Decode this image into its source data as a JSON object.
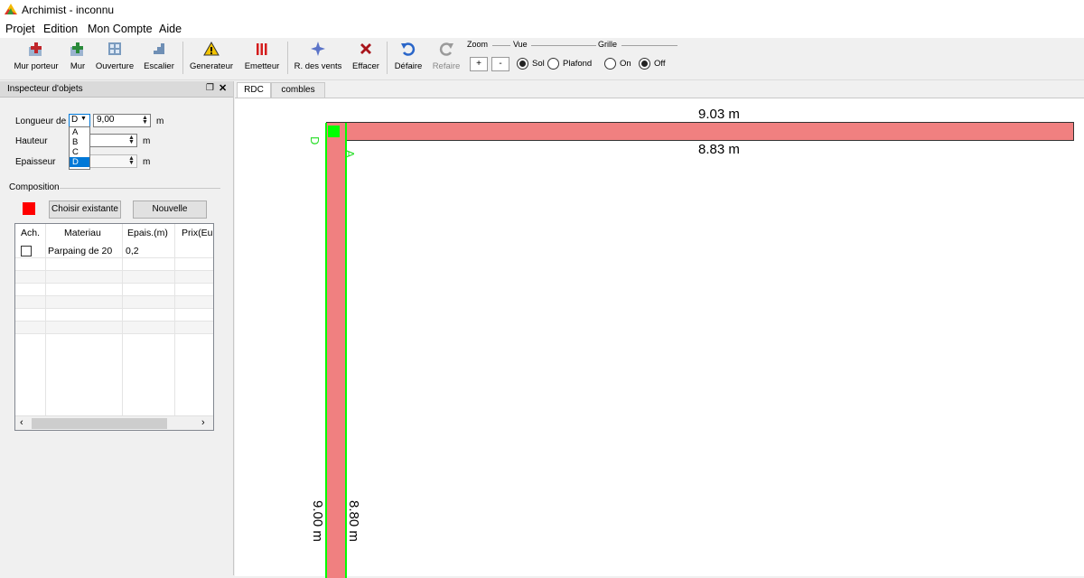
{
  "window": {
    "title": "Archimist - inconnu"
  },
  "menu": [
    "Projet",
    "Edition",
    "Mon Compte",
    "Aide"
  ],
  "toolbar": {
    "tools": [
      {
        "label": "Mur porteur",
        "icon": "wall-add-icon"
      },
      {
        "label": "Mur",
        "icon": "wall-icon"
      },
      {
        "label": "Ouverture",
        "icon": "window-icon"
      },
      {
        "label": "Escalier",
        "icon": "stairs-icon"
      },
      {
        "label": "Generateur",
        "icon": "warning-icon"
      },
      {
        "label": "Emetteur",
        "icon": "radiator-icon"
      },
      {
        "label": "R. des vents",
        "icon": "compass-icon"
      },
      {
        "label": "Effacer",
        "icon": "delete-icon"
      },
      {
        "label": "Défaire",
        "icon": "undo-icon"
      },
      {
        "label": "Refaire",
        "icon": "redo-icon"
      }
    ],
    "zoom": {
      "label": "Zoom",
      "plus": "+",
      "minus": "-"
    },
    "vue": {
      "label": "Vue",
      "options": [
        "Sol",
        "Plafond"
      ],
      "selected": "Sol"
    },
    "grille": {
      "label": "Grille",
      "options": [
        "On",
        "Off"
      ],
      "selected": "Off"
    }
  },
  "inspector": {
    "title": "Inspecteur d'objets",
    "fields": {
      "longueur_label": "Longueur de",
      "longueur_select": "D",
      "longueur_value": "9,00",
      "unit": "m",
      "hauteur_label": "Hauteur",
      "epaisseur_label": "Epaisseur"
    },
    "dropdown_options": [
      "A",
      "B",
      "C",
      "D"
    ],
    "dropdown_selected": "D",
    "composition": {
      "title": "Composition",
      "color": "#ff0000",
      "choose_label": "Choisir existante",
      "new_label": "Nouvelle"
    },
    "table": {
      "headers": [
        "Ach.",
        "Materiau",
        "Epais.(m)",
        "Prix(Eu"
      ],
      "rows": [
        {
          "checked": false,
          "materiau": "Parpaing de 20",
          "epaisseur": "0,2",
          "prix": ""
        }
      ]
    }
  },
  "tabs": [
    "RDC",
    "combles"
  ],
  "active_tab": "RDC",
  "plan": {
    "top_outer": "9.03 m",
    "top_inner": "8.83 m",
    "left_outer": "9.00 m",
    "left_inner": "8.80 m",
    "seg_left": "D",
    "seg_right": "A",
    "wall_color": "#f08080",
    "selection_color": "#00ff00"
  }
}
